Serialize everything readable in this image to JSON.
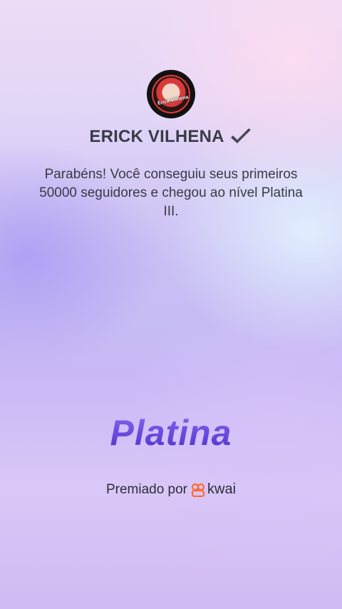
{
  "profile": {
    "avatar_label": "Erick Vilhena",
    "username": "ERICK VILHENA",
    "verified_icon": "checkmark-icon"
  },
  "message": "Parabéns! Você conseguiu seus primeiros 50000 seguidores e chegou ao nível Platina III.",
  "tier": {
    "title": "Platina",
    "color": "#5a3fd6"
  },
  "awarded": {
    "prefix": "Premiado por",
    "brand": "kwai",
    "brand_icon": "kwai-logo-icon",
    "brand_color": "#ff6a2b"
  }
}
